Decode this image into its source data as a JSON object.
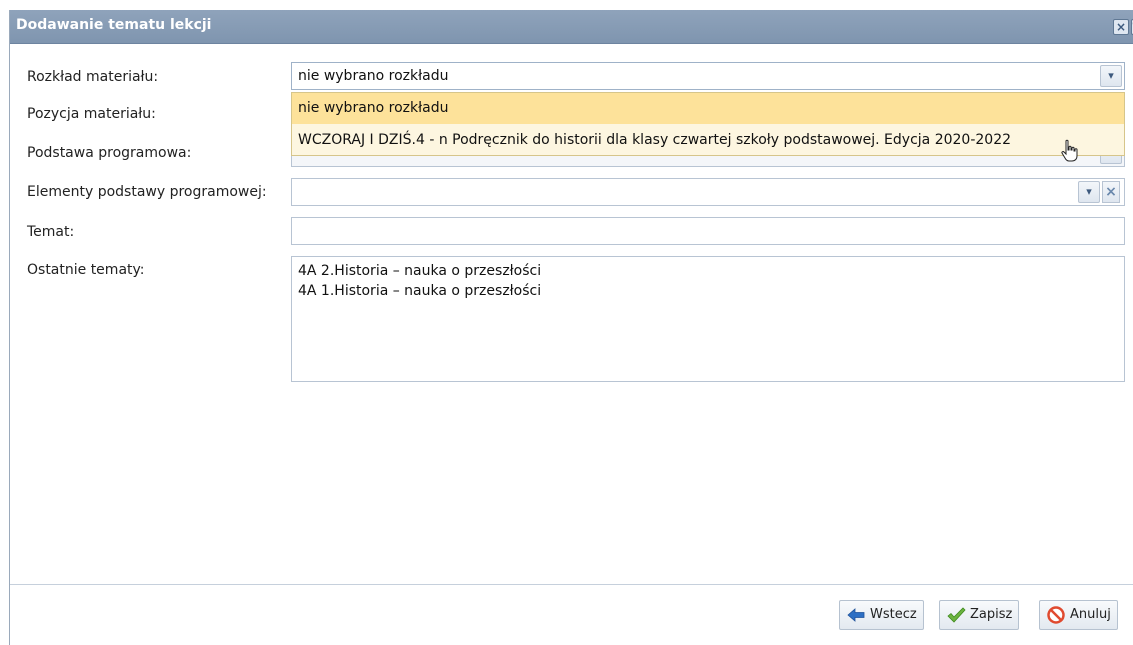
{
  "dialog": {
    "title": "Dodawanie tematu lekcji",
    "close_glyph": "×",
    "help_glyph": "?"
  },
  "form": {
    "rozklad": {
      "label": "Rozkład materiału:",
      "value": "nie wybrano rozkładu",
      "options": [
        "nie wybrano rozkładu",
        "WCZORAJ I DZIŚ.4 - n Podręcznik do historii dla klasy czwartej szkoły podstawowej. Edycja 2020-2022"
      ]
    },
    "pozycja": {
      "label": "Pozycja materiału:"
    },
    "podstawa": {
      "label": "Podstawa programowa:"
    },
    "elementy": {
      "label": "Elementy podstawy programowej:"
    },
    "temat": {
      "label": "Temat:",
      "value": ""
    },
    "ostatnie": {
      "label": "Ostatnie tematy:",
      "items": [
        "4A 2.Historia – nauka o przeszłości",
        "4A 1.Historia – nauka o przeszłości"
      ]
    }
  },
  "footer": {
    "back_label": "Wstecz",
    "save_label": "Zapisz",
    "cancel_label": "Anuluj"
  },
  "icons": {
    "close": "close-icon",
    "help": "help-icon",
    "back": "arrow-left-icon",
    "save": "checkmark-icon",
    "cancel": "forbidden-icon",
    "pointer": "hand-pointer-icon"
  },
  "colors": {
    "titlebar": "#8fa3bb",
    "dropdown_highlight": "#fde29a",
    "dropdown_bg": "#fdf6e0"
  }
}
